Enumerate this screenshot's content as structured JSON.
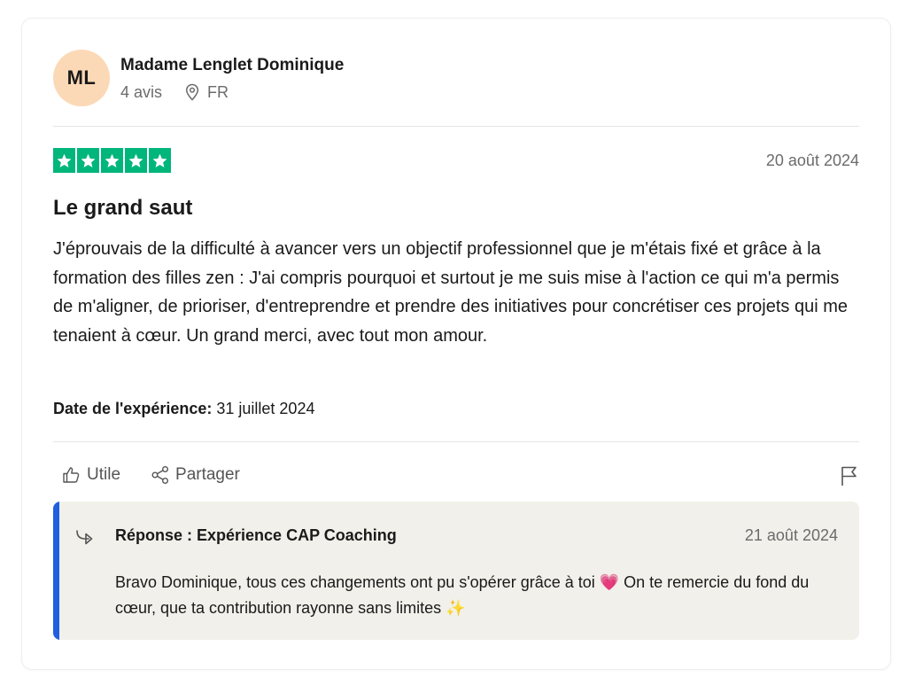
{
  "reviewer": {
    "initials": "ML",
    "name": "Madame Lenglet Dominique",
    "review_count": "4 avis",
    "country": "FR"
  },
  "review": {
    "rating": 5,
    "date": "20 août 2024",
    "title": "Le grand saut",
    "body": "J'éprouvais de la difficulté à avancer vers un objectif professionnel que je m'étais fixé et grâce à la formation des filles zen : J'ai compris pourquoi et surtout je me suis mise à l'action ce qui m'a permis de m'aligner, de prioriser, d'entreprendre et prendre des initiatives pour concrétiser ces projets qui me tenaient à cœur. Un grand merci, avec tout mon amour.",
    "experience_label": "Date de l'expérience:",
    "experience_date": "31 juillet 2024"
  },
  "actions": {
    "useful_label": "Utile",
    "share_label": "Partager"
  },
  "reply": {
    "title": "Réponse : Expérience CAP Coaching",
    "date": "21 août 2024",
    "text": "Bravo Dominique, tous ces changements ont pu s'opérer grâce à toi 💗 On te remercie du fond du cœur, que ta contribution rayonne sans limites ✨"
  },
  "colors": {
    "star_green": "#00b67a",
    "avatar_bg": "#fcd9b6",
    "reply_bg": "#f1f0ea",
    "reply_accent": "#1f5fe0"
  },
  "icons": [
    "location-pin-icon",
    "star-icon",
    "thumbs-up-icon",
    "share-icon",
    "flag-icon",
    "reply-arrow-icon"
  ]
}
